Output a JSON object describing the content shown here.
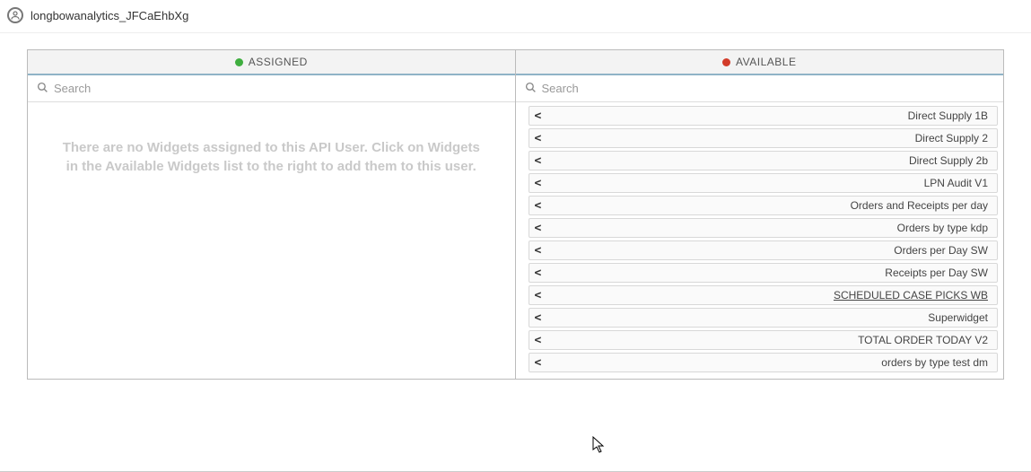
{
  "header": {
    "username": "longbowanalytics_JFCaEhbXg"
  },
  "assigned": {
    "title": "ASSIGNED",
    "search_placeholder": "Search",
    "search_value": "",
    "empty_message": "There are no Widgets assigned to this API User. Click on Widgets in the Available Widgets list to the right to add them to this user."
  },
  "available": {
    "title": "AVAILABLE",
    "search_placeholder": "Search",
    "search_value": "",
    "items": [
      {
        "label": "Direct Supply 1B",
        "highlighted": false
      },
      {
        "label": "Direct Supply 2",
        "highlighted": false
      },
      {
        "label": "Direct Supply 2b",
        "highlighted": false
      },
      {
        "label": "LPN Audit V1",
        "highlighted": false
      },
      {
        "label": "Orders and Receipts per day",
        "highlighted": false
      },
      {
        "label": "Orders by type kdp",
        "highlighted": false
      },
      {
        "label": "Orders per Day SW",
        "highlighted": false
      },
      {
        "label": "Receipts per Day SW",
        "highlighted": false
      },
      {
        "label": "SCHEDULED CASE PICKS WB",
        "highlighted": true
      },
      {
        "label": "Superwidget",
        "highlighted": false
      },
      {
        "label": "TOTAL ORDER TODAY V2",
        "highlighted": false
      },
      {
        "label": "orders by type test dm",
        "highlighted": false
      }
    ]
  }
}
